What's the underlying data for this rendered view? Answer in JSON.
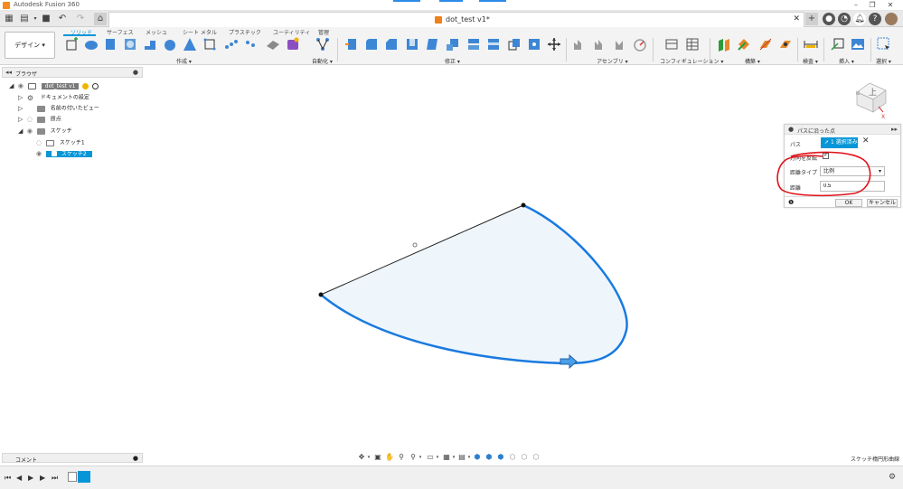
{
  "window": {
    "title": "Autodesk Fusion 360"
  },
  "document": {
    "title": "dot_test v1*"
  },
  "ribbon": {
    "workspace": "デザイン ▾",
    "tabs": [
      "ソリッド",
      "サーフェス",
      "メッシュ",
      "シート メタル",
      "プラスチック",
      "ユーティリティ",
      "管理"
    ],
    "groups": [
      "作成 ▾",
      "自動化 ▾",
      "修正 ▾",
      "アセンブリ ▾",
      "コンフィギュレーション ▾",
      "構築 ▾",
      "検査 ▾",
      "挿入 ▾",
      "選択 ▾"
    ]
  },
  "browser": {
    "title": "ブラウザ",
    "items": [
      {
        "label": "dot_test v1"
      },
      {
        "label": "ドキュメントの設定"
      },
      {
        "label": "名前の付いたビュー"
      },
      {
        "label": "原点"
      },
      {
        "label": "スケッチ"
      },
      {
        "label": "スケッチ1"
      },
      {
        "label": "スケッチ2"
      }
    ]
  },
  "dialog": {
    "title": "パスに沿った点",
    "path_label": "パス",
    "path_value": "1 選択済み",
    "flip_label": "方向を反転",
    "distance_type_label": "距離タイプ",
    "distance_type_value": "比例",
    "distance_label": "距離",
    "distance_value": "0.5",
    "ok_label": "OK",
    "cancel_label": "キャンセル"
  },
  "viewcube": {
    "face_label": "上",
    "axis_x": "X"
  },
  "comments": {
    "title": "コメント"
  },
  "status": {
    "text": "スケッチ楕円形曲線"
  },
  "colors": {
    "accent": "#0696d7",
    "curve": "#1a7ae0",
    "annotation": "#e0141c",
    "profile_fill": "#eef6fc"
  }
}
